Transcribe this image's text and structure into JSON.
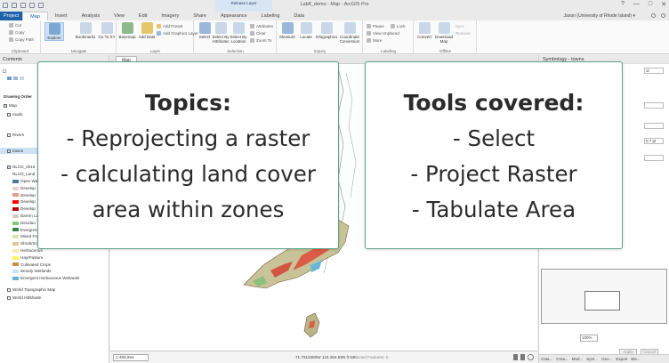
{
  "window": {
    "title": "Lab8_demo - Map - ArcGIS Pro",
    "context_tab": "Release Layer",
    "controls": [
      "?",
      "—",
      "□",
      "✕"
    ],
    "user": "Jason (University of Rhode Island) ▾"
  },
  "tabs": [
    "Project",
    "Map",
    "Insert",
    "Analysis",
    "View",
    "Edit",
    "Imagery",
    "Share",
    "Appearance",
    "Labeling",
    "Data"
  ],
  "active_tab": "Map",
  "ribbon": {
    "clipboard": {
      "label": "Clipboard",
      "items": [
        "Cut",
        "Copy",
        "Copy Path"
      ],
      "paste": "Paste"
    },
    "navigate": {
      "label": "Navigate",
      "explore": "Explore",
      "bookmarks": "Bookmarks",
      "goto": "Go To XY"
    },
    "layer": {
      "label": "Layer",
      "basemap": "Basemap",
      "add_data": "Add Data",
      "add_preset": "Add Preset",
      "add_graphics": "Add Graphics Layer"
    },
    "selection": {
      "label": "Selection",
      "select": "Select",
      "by_attributes": "Select By Attributes",
      "by_location": "Select By Location",
      "attributes": "Attributes",
      "clear": "Clear",
      "zoom_to": "Zoom To"
    },
    "inquiry": {
      "label": "Inquiry",
      "measure": "Measure",
      "locate": "Locate",
      "infographics": "Infographics",
      "coordinate": "Coordinate Conversion"
    },
    "labeling": {
      "label": "Labeling",
      "pause": "Pause",
      "lock": "Lock",
      "view_unplaced": "View Unplaced",
      "more": "More"
    },
    "offline": {
      "label": "Offline",
      "convert": "Convert",
      "download": "Download Map",
      "sync": "Sync",
      "remove": "Remove"
    }
  },
  "contents": {
    "title": "Contents",
    "drawing_order": "Drawing Order",
    "layers": [
      {
        "name": "Map",
        "checked": true,
        "type": "map"
      },
      {
        "name": "roads",
        "checked": false,
        "type": "layer"
      },
      {
        "name": "Rivers",
        "checked": false,
        "type": "layer"
      },
      {
        "name": "towns",
        "checked": true,
        "type": "layer",
        "highlight": true
      },
      {
        "name": "NLCD_2016",
        "checked": true,
        "type": "layer"
      },
      {
        "name": "NLCD_Land",
        "checked": null,
        "type": "sub"
      }
    ],
    "legend": [
      {
        "label": "Open Wa",
        "color": "#5475a8"
      },
      {
        "label": "Develop",
        "color": "#e8d1d1"
      },
      {
        "label": "Develop",
        "color": "#e29e8c"
      },
      {
        "label": "Develop",
        "color": "#ff0000"
      },
      {
        "label": "Develop",
        "color": "#b50000"
      },
      {
        "label": "Barren La",
        "color": "#d2cdc0"
      },
      {
        "label": "Deciduo",
        "color": "#85c77e"
      },
      {
        "label": "Evergree",
        "color": "#38814e"
      },
      {
        "label": "Mixed Fo",
        "color": "#d4e7b0"
      },
      {
        "label": "Shrub/Sc",
        "color": "#dcca8f"
      },
      {
        "label": "Herbaceous",
        "color": "#fde9aa"
      },
      {
        "label": "Hay/Pasture",
        "color": "#fbf65d"
      },
      {
        "label": "Cultivated Crops",
        "color": "#ca9146"
      },
      {
        "label": "Woody Wetlands",
        "color": "#c8e6f8"
      },
      {
        "label": "Emergent Herbaceous Wetlands",
        "color": "#64b3d5"
      }
    ],
    "basemaps": [
      "World Topographic Map",
      "World Hillshade"
    ]
  },
  "map": {
    "tab": "Map",
    "scale": "1:488,994",
    "coords": "71.7913380W 124.364.59N ft US",
    "selected": "Selected Features: 0"
  },
  "symbology": {
    "title": "Symbology - towns",
    "fields": [
      "ol",
      "",
      "",
      "0.7 pt",
      ""
    ],
    "zoom": "100%",
    "apply": "Apply",
    "cancel": "Cancel",
    "bottom_tabs": [
      "Cata...",
      "Crea...",
      "Mod...",
      "Sym...",
      "Geo...",
      "Export",
      "Ele..."
    ]
  },
  "cards": {
    "topics": {
      "heading": "Topics:",
      "lines": [
        "- Reprojecting a raster",
        "- calculating land cover",
        "area within zones"
      ]
    },
    "tools": {
      "heading": "Tools covered:",
      "lines": [
        "- Select",
        "- Project Raster",
        "- Tabulate Area"
      ]
    },
    "border_color": "#5aa48a"
  }
}
